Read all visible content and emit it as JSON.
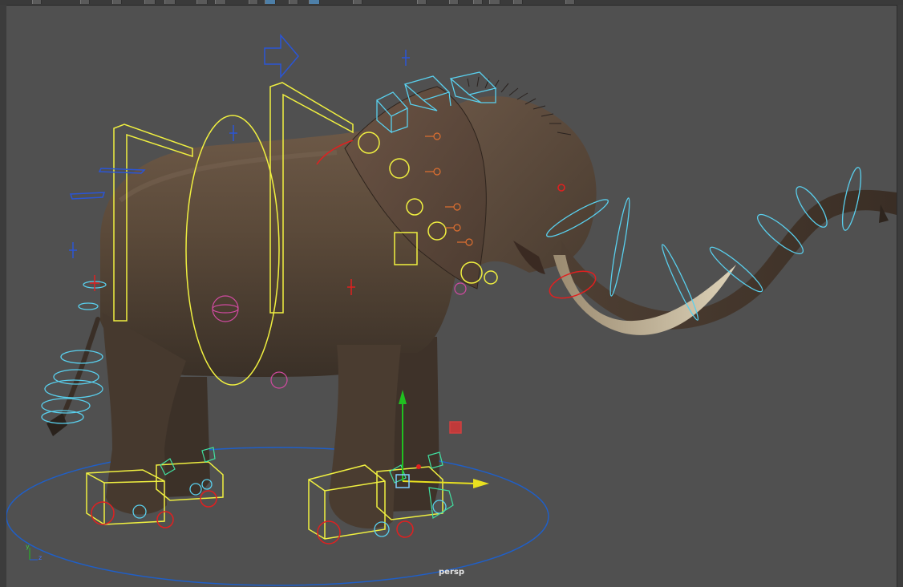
{
  "viewport": {
    "camera_label": "persp",
    "axes": {
      "y": "y",
      "z": "z"
    }
  },
  "colors": {
    "background": "#505050",
    "rig_yellow": "#f0f040",
    "rig_cyan": "#59d0ee",
    "rig_blue": "#2a55d6",
    "rig_red": "#e02020",
    "rig_magenta": "#d04aa0",
    "ground_circle": "#1f5fc8",
    "manip_x": "#e8e020",
    "manip_y": "#20c020"
  },
  "icons": [
    "move-manipulator-icon",
    "direction-arrow-icon"
  ]
}
